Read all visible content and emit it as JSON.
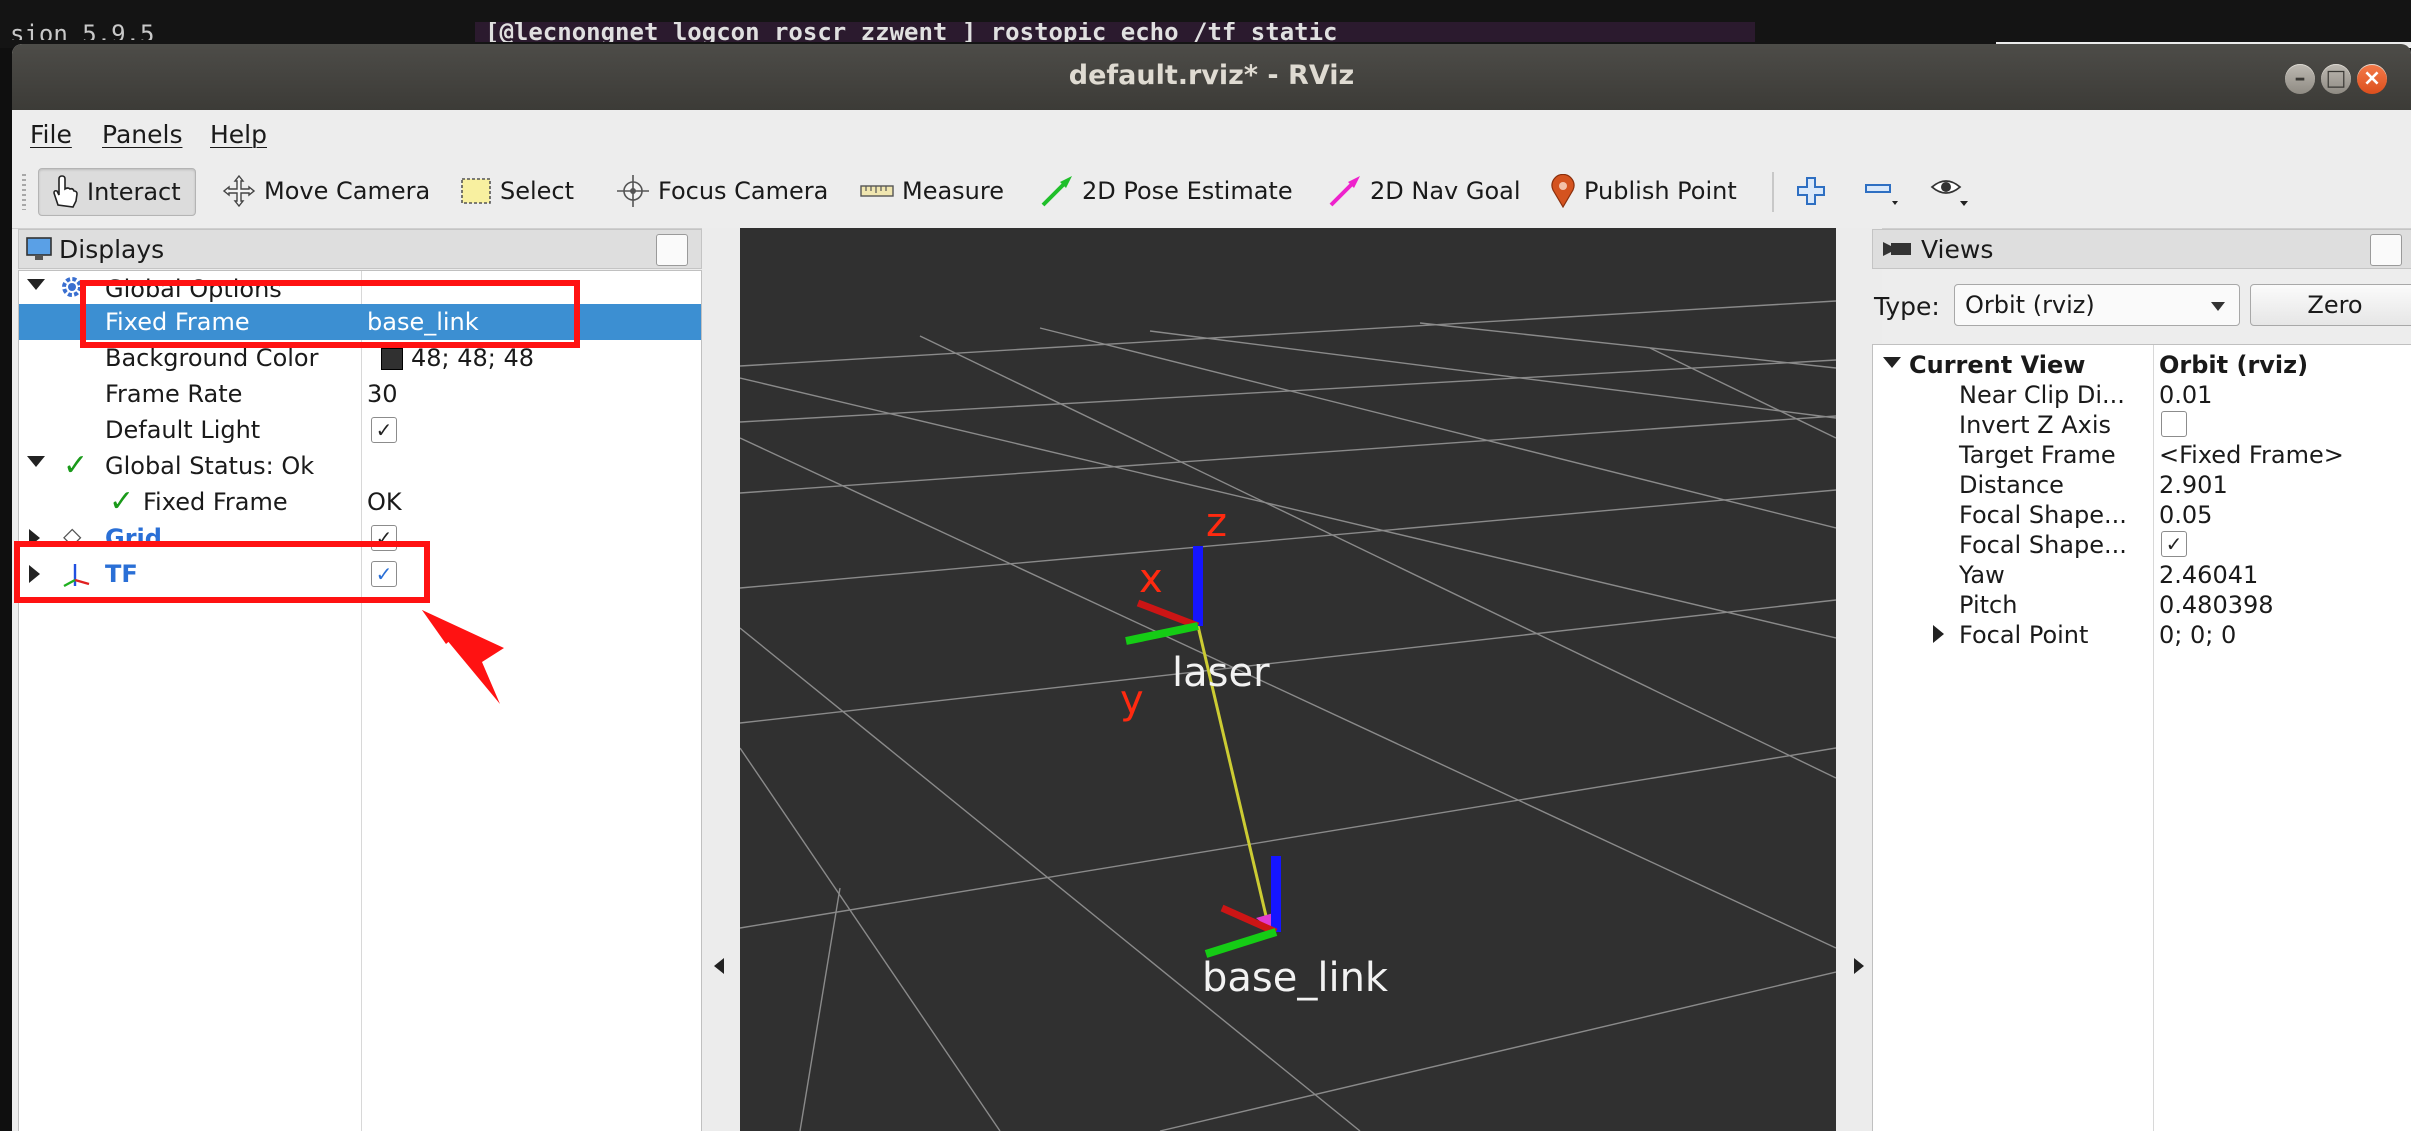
{
  "background_terminal": {
    "left_text": "sion 5.9.5",
    "middle_text": "[@lecnongnet logcon roscr zzwent ] rostopic echo /tf_static"
  },
  "window": {
    "title": "default.rviz* - RViz"
  },
  "menu": [
    "File",
    "Panels",
    "Help"
  ],
  "toolbar": {
    "tools": [
      {
        "label": "Interact",
        "icon": "hand-pointer-icon"
      },
      {
        "label": "Move Camera",
        "icon": "move-camera-icon"
      },
      {
        "label": "Select",
        "icon": "select-box-icon"
      },
      {
        "label": "Focus Camera",
        "icon": "focus-camera-icon"
      },
      {
        "label": "Measure",
        "icon": "ruler-icon"
      },
      {
        "label": "2D Pose Estimate",
        "icon": "green-arrow-icon"
      },
      {
        "label": "2D Nav Goal",
        "icon": "magenta-arrow-icon"
      },
      {
        "label": "Publish Point",
        "icon": "map-pin-icon"
      }
    ],
    "extra_icons": [
      "plus-icon",
      "minus-icon",
      "eye-icon"
    ]
  },
  "displays": {
    "title": "Displays",
    "rows": [
      {
        "name": "Global Options",
        "value": ""
      },
      {
        "name": "Fixed Frame",
        "value": "base_link"
      },
      {
        "name": "Background Color",
        "value": "48; 48; 48"
      },
      {
        "name": "Frame Rate",
        "value": "30"
      },
      {
        "name": "Default Light",
        "value": "✓"
      },
      {
        "name": "Global Status: Ok",
        "value": ""
      },
      {
        "name": "Fixed Frame",
        "value": "OK"
      },
      {
        "name": "Grid",
        "value": "✓"
      },
      {
        "name": "TF",
        "value": "✓"
      }
    ]
  },
  "viewport": {
    "background_color": "#303030",
    "frames": [
      {
        "name": "laser",
        "axis_labels": [
          "z",
          "x",
          "y"
        ]
      },
      {
        "name": "base_link"
      }
    ]
  },
  "views": {
    "title": "Views",
    "type_label": "Type:",
    "type_value": "Orbit (rviz)",
    "zero_button": "Zero",
    "header": {
      "name": "Current View",
      "value": "Orbit (rviz)"
    },
    "rows": [
      {
        "name": "Near Clip Di...",
        "value": "0.01"
      },
      {
        "name": "Invert Z Axis",
        "value": ""
      },
      {
        "name": "Target Frame",
        "value": "<Fixed Frame>"
      },
      {
        "name": "Distance",
        "value": "2.901"
      },
      {
        "name": "Focal Shape...",
        "value": "0.05"
      },
      {
        "name": "Focal Shape...",
        "value": "✓"
      },
      {
        "name": "Yaw",
        "value": "2.46041"
      },
      {
        "name": "Pitch",
        "value": "0.480398"
      },
      {
        "name": "Focal Point",
        "value": "0; 0; 0"
      }
    ]
  },
  "colors": {
    "selection": "#3c8fd2",
    "annotation": "#ff1212",
    "link_blue": "#2a6fd6"
  }
}
